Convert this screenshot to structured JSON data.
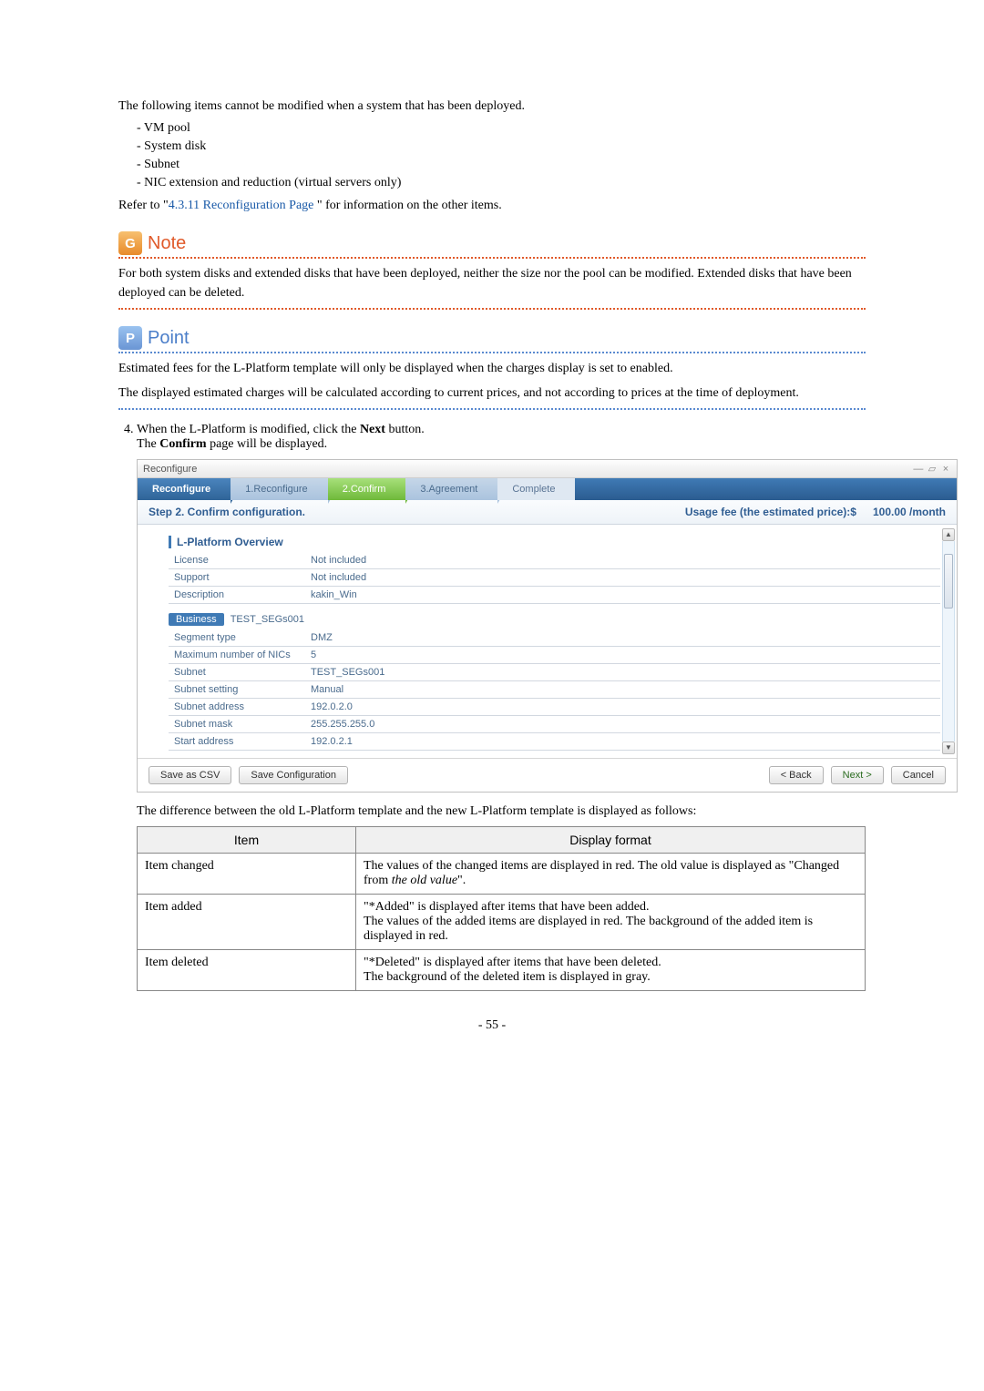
{
  "intro_text": "The following items cannot be modified when a system that has been deployed.",
  "dash_items": [
    "VM pool",
    "System disk",
    "Subnet",
    "NIC extension and reduction (virtual servers only)"
  ],
  "refer_pre": "Refer to \"",
  "refer_link": "4.3.11 Reconfiguration Page ",
  "refer_post": "\" for information on the other items.",
  "note_label": "Note",
  "note_body": "For both system disks and extended disks that have been deployed, neither the size nor the pool can be modified. Extended disks that have been deployed can be deleted.",
  "point_label": "Point",
  "point_body_1": "Estimated fees for the L-Platform template will only be displayed when the charges display is set to enabled.",
  "point_body_2": "The displayed estimated charges will be calculated according to current prices, and not according to prices at the time of deployment.",
  "step4_pre": "When the L-Platform is modified, click the ",
  "step4_bold": "Next",
  "step4_post": " button.",
  "step4_line2_pre": "The ",
  "step4_line2_bold": "Confirm",
  "step4_line2_post": " page will be displayed.",
  "shot": {
    "title": "Reconfigure",
    "steps": {
      "title": "Reconfigure",
      "s1": "1.Reconfigure",
      "s2": "2.Confirm",
      "s3": "3.Agreement",
      "s4": "Complete"
    },
    "substep_left": "Step 2. Confirm configuration.",
    "usage_label": "Usage fee (the estimated price):$",
    "usage_value": "100.00 /month",
    "overview_header": "L-Platform Overview",
    "overview": [
      {
        "k": "License",
        "v": "Not included"
      },
      {
        "k": "Support",
        "v": "Not included"
      },
      {
        "k": "Description",
        "v": "kakin_Win"
      }
    ],
    "biz_tag": "Business",
    "biz_name": "TEST_SEGs001",
    "segment": [
      {
        "k": "Segment type",
        "v": "DMZ"
      },
      {
        "k": "Maximum number of NICs",
        "v": "5"
      },
      {
        "k": "Subnet",
        "v": "TEST_SEGs001"
      },
      {
        "k": "Subnet setting",
        "v": "Manual"
      },
      {
        "k": "Subnet address",
        "v": "192.0.2.0"
      },
      {
        "k": "Subnet mask",
        "v": "255.255.255.0"
      },
      {
        "k": "Start address",
        "v": "192.0.2.1"
      }
    ],
    "buttons": {
      "save_csv": "Save as CSV",
      "save_cfg": "Save Configuration",
      "back": "< Back",
      "next": "Next >",
      "cancel": "Cancel"
    }
  },
  "diff_intro": "The difference between the old L-Platform template and the new L-Platform template is displayed as follows:",
  "diff_headers": {
    "item": "Item",
    "format": "Display format"
  },
  "diff_rows": [
    {
      "item": "Item changed",
      "format_pre": "The values of the changed items are displayed in red. The old value is displayed as \"Changed from ",
      "format_italic": "the old value",
      "format_post": "\"."
    },
    {
      "item": "Item added",
      "format_plain": "\"*Added\" is displayed after items that have been added.\nThe values of the added items are displayed in red. The background of the added item is displayed in red."
    },
    {
      "item": "Item deleted",
      "format_plain": "\"*Deleted\" is displayed after items that have been deleted.\nThe background of the deleted item is displayed in gray."
    }
  ],
  "page_number": "- 55 -"
}
